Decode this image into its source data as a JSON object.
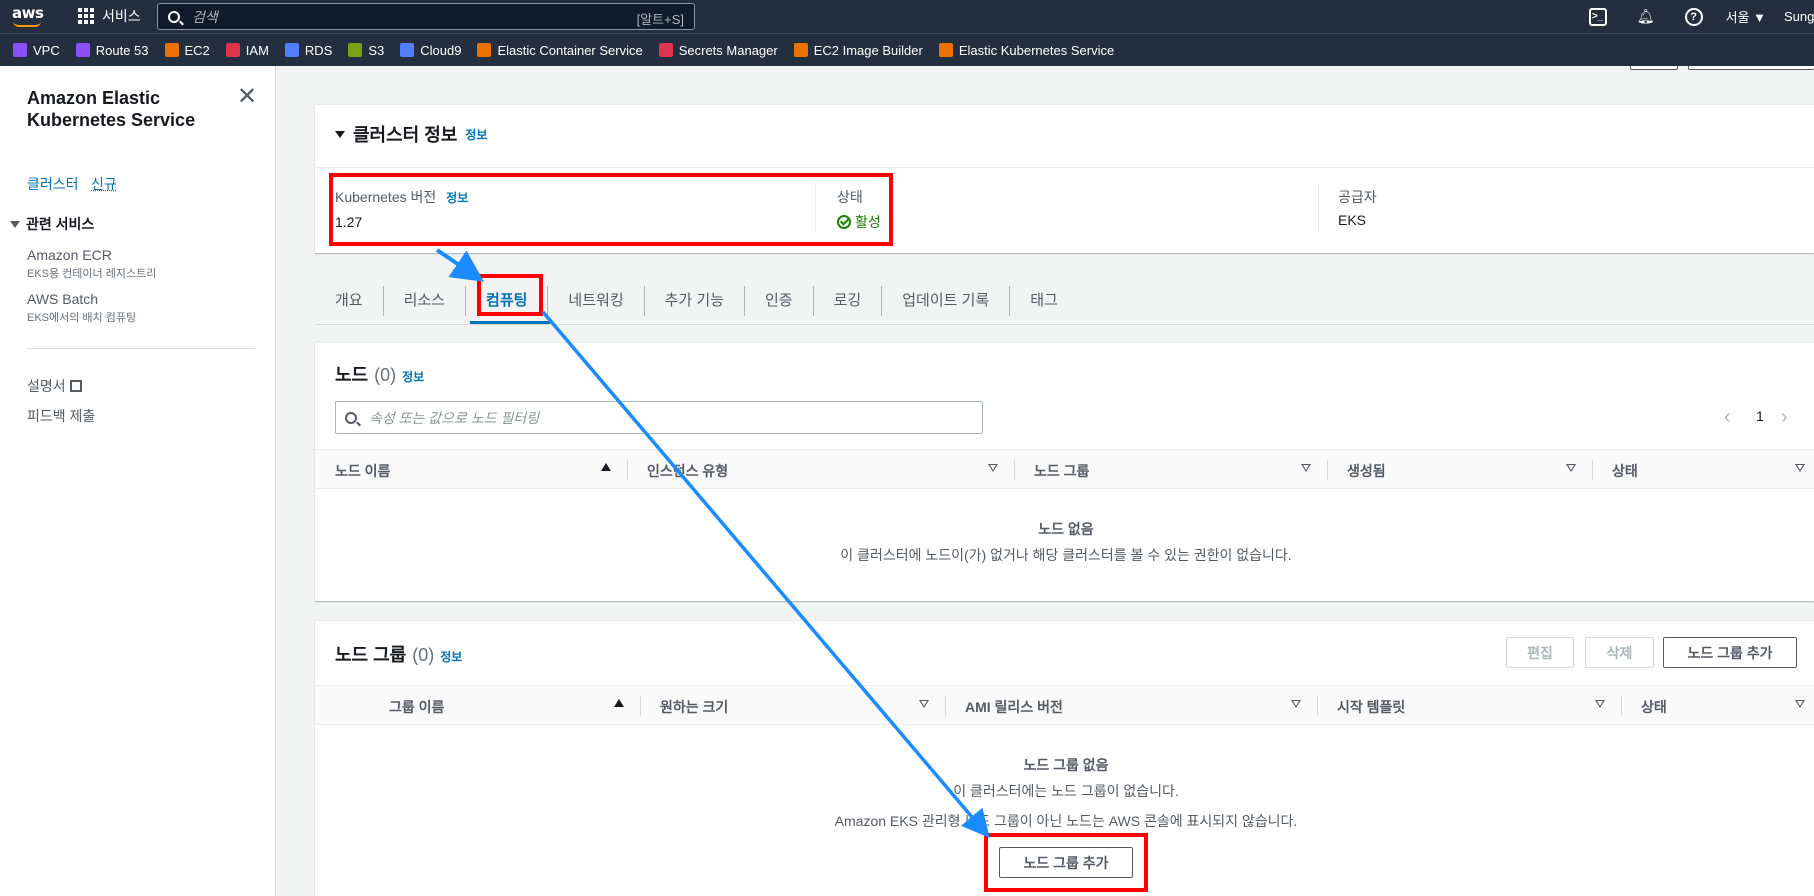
{
  "topnav": {
    "logo": "aws",
    "services_label": "서비스",
    "search_placeholder": "검색",
    "search_shortcut": "[알트+S]",
    "region": "서울 ▼",
    "user": "Sung"
  },
  "favorites": [
    {
      "label": "VPC",
      "color": "#8c4fff"
    },
    {
      "label": "Route 53",
      "color": "#8c4fff"
    },
    {
      "label": "EC2",
      "color": "#ed7100"
    },
    {
      "label": "IAM",
      "color": "#dd344c"
    },
    {
      "label": "RDS",
      "color": "#527fff"
    },
    {
      "label": "S3",
      "color": "#7aa116"
    },
    {
      "label": "Cloud9",
      "color": "#527fff"
    },
    {
      "label": "Elastic Container Service",
      "color": "#ed7100"
    },
    {
      "label": "Secrets Manager",
      "color": "#dd344c"
    },
    {
      "label": "EC2 Image Builder",
      "color": "#ed7100"
    },
    {
      "label": "Elastic Kubernetes Service",
      "color": "#ed7100"
    }
  ],
  "sidebar": {
    "title_line1": "Amazon Elastic",
    "title_line2": "Kubernetes Service",
    "clusters_label": "클러스터",
    "new_label": "신규",
    "related_section": "관련 서비스",
    "ecr_label": "Amazon ECR",
    "ecr_sub": "EKS용 컨테이너 레지스트리",
    "batch_label": "AWS Batch",
    "batch_sub": "EKS에서의 배치 컴퓨팅",
    "docs_label": "설명서",
    "feedback_label": "피드백 제출"
  },
  "cluster_info": {
    "title": "클러스터 정보",
    "info": "정보",
    "k8s_version_label": "Kubernetes 버전",
    "k8s_version_info": "정보",
    "k8s_version_value": "1.27",
    "status_label": "상태",
    "status_value": "활성",
    "provider_label": "공급자",
    "provider_value": "EKS"
  },
  "tabs": [
    "개요",
    "리소스",
    "컴퓨팅",
    "네트워킹",
    "추가 기능",
    "인증",
    "로깅",
    "업데이트 기록",
    "태그"
  ],
  "active_tab": "컴퓨팅",
  "nodes": {
    "title": "노드",
    "count": "(0)",
    "info": "정보",
    "filter_placeholder": "속성 또는 값으로 노드 필터링",
    "page": "1",
    "columns": [
      "노드 이름",
      "인스턴스 유형",
      "노드 그룹",
      "생성됨",
      "상태"
    ],
    "empty_title": "노드 없음",
    "empty_desc": "이 클러스터에 노드이(가) 없거나 해당 클러스터를 볼 수 있는 권한이 없습니다."
  },
  "node_groups": {
    "title": "노드 그룹",
    "count": "(0)",
    "info": "정보",
    "edit_button": "편집",
    "delete_button": "삭제",
    "add_button": "노드 그룹 추가",
    "columns": [
      "그룹 이름",
      "원하는 크기",
      "AMI 릴리스 버전",
      "시작 템플릿",
      "상태"
    ],
    "empty_title": "노드 그룹 없음",
    "empty_desc1": "이 클러스터에는 노드 그룹이 없습니다.",
    "empty_desc2": "Amazon EKS 관리형 노드 그룹이 아닌 노드는 AWS 콘솔에 표시되지 않습니다.",
    "empty_add_button": "노드 그룹 추가"
  },
  "annotations": {
    "highlight_color": "#ff0000",
    "arrow_color": "#1a8cff"
  }
}
